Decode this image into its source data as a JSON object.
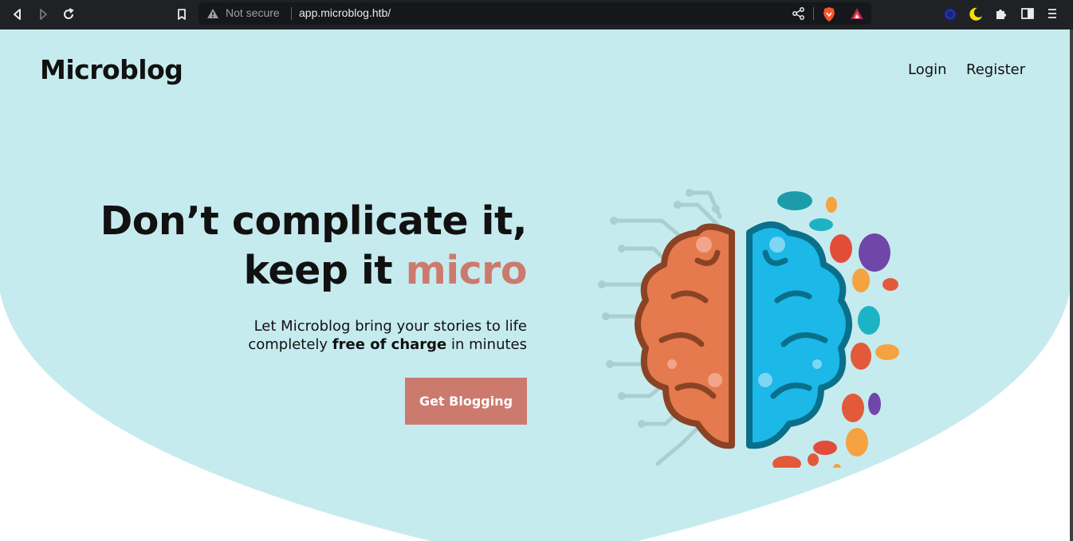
{
  "browser": {
    "security_label": "Not secure",
    "url": "app.microblog.htb/"
  },
  "site": {
    "brand": "Microblog",
    "nav": {
      "login": "Login",
      "register": "Register"
    }
  },
  "hero": {
    "headline_line1": "Don’t complicate it,",
    "headline_line2_prefix": "keep it ",
    "headline_line2_accent": "micro",
    "subtext_line1": "Let Microblog bring your stories to life",
    "subtext_line2_prefix": "completely ",
    "subtext_line2_bold": "free of charge",
    "subtext_line2_suffix": " in minutes",
    "cta_label": "Get Blogging"
  },
  "colors": {
    "hero_bg": "#c6ebee",
    "accent": "#cc7a6e",
    "brain_left": "#e57a4e",
    "brain_right": "#1bb8e8",
    "chrome": "#202124"
  },
  "icons": [
    "back-icon",
    "forward-icon",
    "reload-icon",
    "bookmark-icon",
    "warning-icon",
    "share-icon",
    "brave-shields-icon",
    "brave-rewards-icon",
    "extension-globe-icon",
    "dark-reader-icon",
    "extensions-puzzle-icon",
    "sidebar-icon",
    "menu-icon"
  ]
}
